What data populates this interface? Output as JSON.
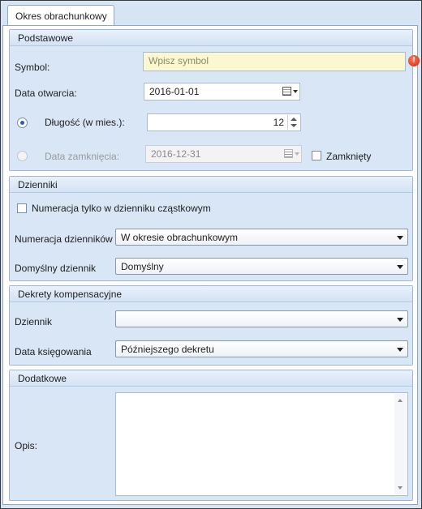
{
  "tab": {
    "label": "Okres obrachunkowy"
  },
  "podstawowe": {
    "header": "Podstawowe",
    "symbol_label": "Symbol:",
    "symbol_placeholder": "Wpisz symbol",
    "data_otwarcia_label": "Data otwarcia:",
    "data_otwarcia_value": "2016-01-01",
    "dlugosc_label": "Długość (w mies.):",
    "dlugosc_value": "12",
    "data_zamkniecia_label": "Data zamknięcia:",
    "data_zamkniecia_value": "2016-12-31",
    "zamkniety_label": "Zamknięty"
  },
  "dzienniki": {
    "header": "Dzienniki",
    "numeracja_czastkowy_label": "Numeracja tylko w dzienniku cząstkowym",
    "numeracja_label": "Numeracja dzienników",
    "numeracja_value": "W okresie obrachunkowym",
    "domyslny_label": "Domyślny dziennik",
    "domyslny_value": "Domyślny"
  },
  "dekrety": {
    "header": "Dekrety kompensacyjne",
    "dziennik_label": "Dziennik",
    "dziennik_value": "",
    "data_ksiegowania_label": "Data księgowania",
    "data_ksiegowania_value": "Późniejszego dekretu"
  },
  "dodatkowe": {
    "header": "Dodatkowe",
    "opis_label": "Opis:",
    "opis_value": ""
  },
  "icons": {
    "warning": "warning-icon",
    "calendar": "calendar-icon"
  },
  "colors": {
    "panel_bg": "#d8e6f5",
    "header_bg": "#e9f1fb",
    "symbol_bg": "#fbf8cf",
    "warning": "#d6210f"
  }
}
